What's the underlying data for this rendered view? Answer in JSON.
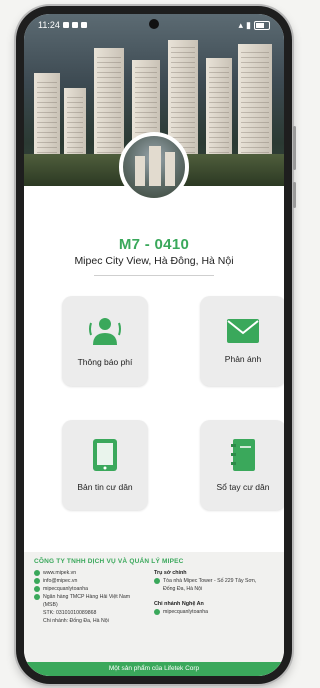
{
  "status_bar": {
    "time": "11:24"
  },
  "header": {
    "unit_code": "M7 - 0410",
    "address": "Mipec City View, Hà Đông, Hà Nội"
  },
  "menu": [
    {
      "label": "Thông báo phí",
      "icon": "person-icon"
    },
    {
      "label": "Phản ánh",
      "icon": "mail-icon"
    },
    {
      "label": "Bản tin cư dân",
      "icon": "tablet-icon"
    },
    {
      "label": "Sổ tay cư dân",
      "icon": "notebook-icon"
    }
  ],
  "footer": {
    "company": "CÔNG TY TNHH DỊCH VỤ VÀ QUẢN LÝ MIPEC",
    "contacts": [
      "www.mipek.vn",
      "info@mipec.vn",
      "mipecquanlytoanha",
      "Ngân hàng TMCP Hàng Hải Việt Nam (MSB)",
      "STK: 03101010089868",
      "Chi nhánh: Đống Đa, Hà Nội"
    ],
    "hq_title": "Trụ sở chính",
    "hq_address": "Tòa nhà Mipec Tower - Số 229 Tây Sơn, Đống Đa, Hà Nội",
    "branch_title": "Chi nhánh Nghệ An",
    "branch_link": "mipecquanlytoanha",
    "bottom_text": "Một sản phẩm của Lifetek Corp"
  },
  "colors": {
    "accent": "#3aa85b",
    "card_bg": "#ececec"
  }
}
